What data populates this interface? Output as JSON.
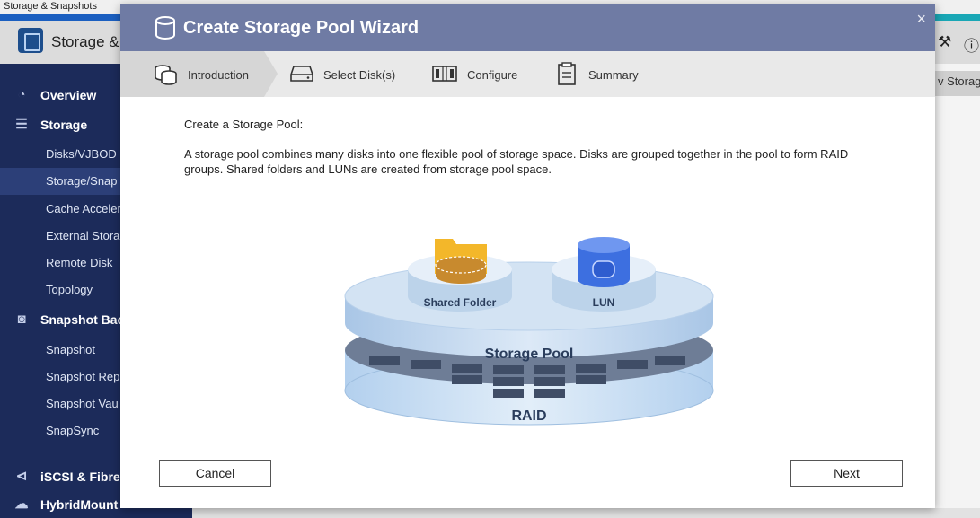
{
  "window": {
    "title": "Storage & Snapshots"
  },
  "app": {
    "title": "Storage & S",
    "right_tab_label": "v Storag"
  },
  "sidebar": {
    "items": [
      {
        "label": "Overview",
        "level": "top",
        "icon": "gauge-icon"
      },
      {
        "label": "Storage",
        "level": "top",
        "icon": "database-icon"
      },
      {
        "label": "Disks/VJBOD",
        "level": "sub"
      },
      {
        "label": "Storage/Snap",
        "level": "sub",
        "active": true
      },
      {
        "label": "Cache Acceler",
        "level": "sub"
      },
      {
        "label": "External Stora",
        "level": "sub"
      },
      {
        "label": "Remote Disk",
        "level": "sub"
      },
      {
        "label": "Topology",
        "level": "sub"
      },
      {
        "label": "Snapshot Bac",
        "level": "top",
        "icon": "camera-icon"
      },
      {
        "label": "Snapshot",
        "level": "sub"
      },
      {
        "label": "Snapshot Rep",
        "level": "sub"
      },
      {
        "label": "Snapshot Vau",
        "level": "sub"
      },
      {
        "label": "SnapSync",
        "level": "sub"
      },
      {
        "label": "iSCSI & Fibre C",
        "level": "top",
        "icon": "share-icon"
      },
      {
        "label": "HybridMount",
        "level": "top",
        "icon": "cloud-icon"
      }
    ]
  },
  "dialog": {
    "title": "Create Storage Pool Wizard",
    "close_glyph": "×",
    "steps": [
      {
        "label": "Introduction",
        "active": true,
        "icon": "stacked-disks-icon"
      },
      {
        "label": "Select Disk(s)",
        "active": false,
        "icon": "hard-drive-icon"
      },
      {
        "label": "Configure",
        "active": false,
        "icon": "raid-array-icon"
      },
      {
        "label": "Summary",
        "active": false,
        "icon": "clipboard-icon"
      }
    ],
    "heading": "Create a Storage Pool:",
    "description": "A storage pool combines many disks into one flexible pool of storage space. Disks are grouped together in the pool to form RAID groups. Shared folders and LUNs are created from storage pool space.",
    "diagram": {
      "shared_folder": "Shared Folder",
      "lun": "LUN",
      "storage_pool": "Storage Pool",
      "raid": "RAID"
    },
    "buttons": {
      "cancel": "Cancel",
      "next": "Next"
    }
  },
  "colors": {
    "header": "#6f7ba4",
    "sidebar": "#1c2b5a",
    "pool": "#cde0f2",
    "lun": "#3d6fe0",
    "folder": "#f3b72a"
  }
}
